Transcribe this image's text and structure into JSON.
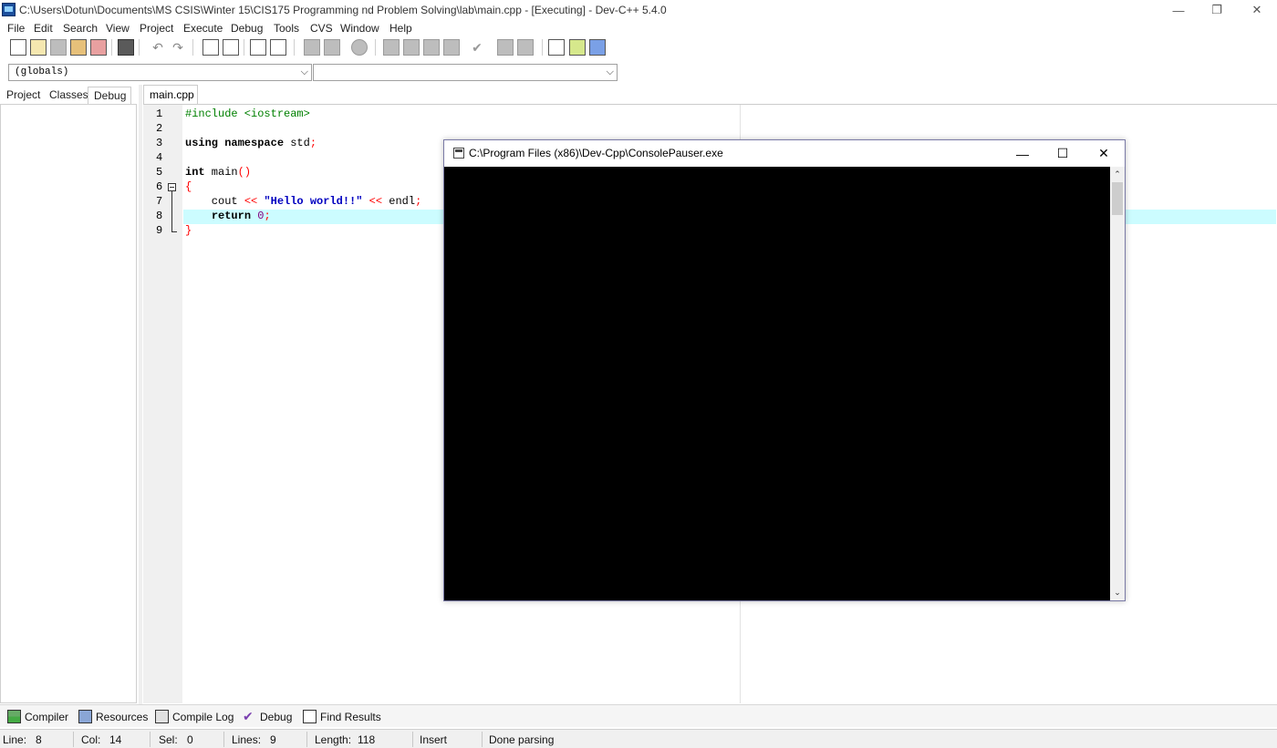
{
  "window": {
    "title": "C:\\Users\\Dotun\\Documents\\MS CSIS\\Winter 15\\CIS175 Programming nd Problem Solving\\lab\\main.cpp - [Executing] - Dev-C++ 5.4.0",
    "minimize_glyph": "—",
    "restore_glyph": "❐",
    "close_glyph": "✕"
  },
  "menu": [
    "File",
    "Edit",
    "Search",
    "View",
    "Project",
    "Execute",
    "Debug",
    "Tools",
    "CVS",
    "Window",
    "Help"
  ],
  "combos": {
    "left_value": "(globals)",
    "right_value": "",
    "chevron": "⌵"
  },
  "left_tabs": [
    "Project",
    "Classes",
    "Debug"
  ],
  "editor": {
    "tab_label": "main.cpp",
    "line_numbers": [
      "1",
      "2",
      "3",
      "4",
      "5",
      "6",
      "7",
      "8",
      "9"
    ],
    "lines": {
      "l1_pp": "#include <iostream>",
      "l3_kw": "using namespace",
      "l3_rest": " std",
      "l3_sym": ";",
      "l5_kw": "int",
      "l5_rest": " main",
      "l5_sym": "()",
      "l6_sym": "{",
      "l7_pre": "    cout ",
      "l7_op1": "<<",
      "l7_str": " \"Hello world!!\"",
      "l7_op2": " <<",
      "l7_rest": " endl",
      "l7_sym": ";",
      "l8_pre": "    ",
      "l8_kw": "return",
      "l8_num": " 0",
      "l8_sym": ";",
      "l9_sym": "}"
    }
  },
  "console": {
    "title": "C:\\Program Files (x86)\\Dev-Cpp\\ConsolePauser.exe",
    "minimize_glyph": "—",
    "maximize_glyph": "☐",
    "close_glyph": "✕",
    "scroll_up_glyph": "⌃",
    "scroll_down_glyph": "⌄"
  },
  "bottom_tabs": [
    "Compiler",
    "Resources",
    "Compile Log",
    "Debug",
    "Find Results"
  ],
  "status": {
    "line_label": "Line:",
    "line_value": "8",
    "col_label": "Col:",
    "col_value": "14",
    "sel_label": "Sel:",
    "sel_value": "0",
    "lines_label": "Lines:",
    "lines_value": "9",
    "length_label": "Length:",
    "length_value": "118",
    "mode": "Insert",
    "message": "Done parsing"
  },
  "colors": {
    "current_line": "#ccfcff",
    "preprocessor": "#008000",
    "symbol": "#ff0000",
    "string": "#0000c0",
    "number": "#800080",
    "console_bg": "#000000"
  }
}
